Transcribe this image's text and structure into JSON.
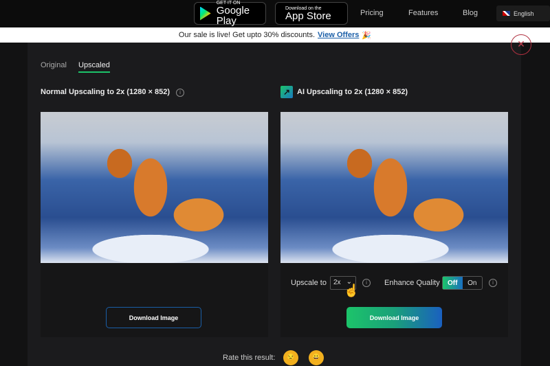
{
  "nav": {
    "google_play": {
      "small": "GET IT ON",
      "large": "Google Play"
    },
    "app_store": {
      "small": "Download on the",
      "large": "App Store"
    },
    "links": [
      "Pricing",
      "Features",
      "Blog"
    ],
    "language": "English"
  },
  "banner": {
    "text": "Our sale is live! Get upto 30% discounts.",
    "link": "View Offers",
    "emoji": "🎉"
  },
  "tabs": [
    "Original",
    "Upscaled"
  ],
  "active_tab": "Upscaled",
  "left": {
    "heading": "Normal Upscaling to 2x (1280 × 852)",
    "download": "Download Image"
  },
  "right": {
    "heading": "AI Upscaling to 2x (1280 × 852)",
    "upscale_label": "Upscale to",
    "upscale_value": "2x",
    "enhance_label": "Enhance Quality",
    "toggle_off": "Off",
    "toggle_on": "On",
    "enhance_state": "Off",
    "download": "Download Image"
  },
  "rating": {
    "label": "Rate this result:",
    "options": [
      "😒",
      "😀"
    ]
  },
  "colors": {
    "accent_green": "#1cc46a",
    "accent_blue": "#1a5fc0",
    "close_red": "#b03040"
  }
}
